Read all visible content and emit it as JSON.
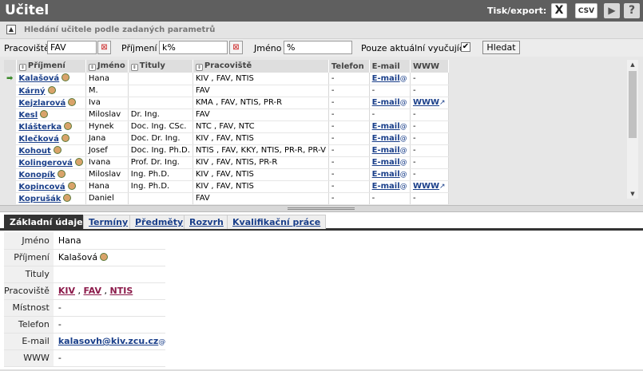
{
  "title": "Učitel",
  "export_label": "Tisk/export:",
  "icons": {
    "excel": "X",
    "csv": "CSV",
    "play": "▶",
    "help": "?"
  },
  "search": {
    "heading": "Hledání učitele podle zadaných parametrů",
    "pracoviste_label": "Pracoviště",
    "pracoviste_value": "FAV",
    "prijmeni_label": "Příjmení",
    "prijmeni_value": "k%",
    "jmeno_label": "Jméno",
    "jmeno_value": "%",
    "aktualni_label": "Pouze aktuální vyučující",
    "aktualni_checked": "✔",
    "button": "Hledat"
  },
  "grid": {
    "headers": [
      "Příjmení",
      "Jméno",
      "Tituly",
      "Pracoviště",
      "Telefon",
      "E-mail",
      "WWW"
    ],
    "rows": [
      {
        "prijmeni": "Kalašová",
        "person": true,
        "jmeno": "Hana",
        "tituly": "",
        "pracoviste": "KIV , FAV, NTIS",
        "telefon": "-",
        "email": "E-mail",
        "www": "-",
        "current": true
      },
      {
        "prijmeni": "Kárný",
        "person": true,
        "jmeno": "M.",
        "tituly": "",
        "pracoviste": "FAV",
        "telefon": "-",
        "email": "-",
        "www": "-"
      },
      {
        "prijmeni": "Kejzlarová",
        "person": true,
        "jmeno": "Iva",
        "tituly": "",
        "pracoviste": "KMA , FAV, NTIS, PR-R",
        "telefon": "-",
        "email": "E-mail",
        "www": "WWW"
      },
      {
        "prijmeni": "Kesl",
        "person": true,
        "jmeno": "Miloslav",
        "tituly": "Dr. Ing.",
        "pracoviste": "FAV",
        "telefon": "-",
        "email": "-",
        "www": "-"
      },
      {
        "prijmeni": "Klášterka",
        "person": true,
        "jmeno": "Hynek",
        "tituly": "Doc. Ing. CSc.",
        "pracoviste": "NTC , FAV, NTC",
        "telefon": "-",
        "email": "E-mail",
        "www": "-"
      },
      {
        "prijmeni": "Klečková",
        "person": true,
        "jmeno": "Jana",
        "tituly": "Doc. Dr. Ing.",
        "pracoviste": "KIV , FAV, NTIS",
        "telefon": "-",
        "email": "E-mail",
        "www": "-"
      },
      {
        "prijmeni": "Kohout",
        "person": true,
        "jmeno": "Josef",
        "tituly": "Doc. Ing. Ph.D.",
        "pracoviste": "NTIS , FAV, KKY, NTIS, PR-R, PR-V",
        "telefon": "-",
        "email": "E-mail",
        "www": "-"
      },
      {
        "prijmeni": "Kolingerová",
        "person": true,
        "jmeno": "Ivana",
        "tituly": "Prof. Dr. Ing.",
        "pracoviste": "KIV , FAV, NTIS, PR-R",
        "telefon": "-",
        "email": "E-mail",
        "www": "-"
      },
      {
        "prijmeni": "Konopík",
        "person": true,
        "jmeno": "Miloslav",
        "tituly": "Ing. Ph.D.",
        "pracoviste": "KIV , FAV, NTIS",
        "telefon": "-",
        "email": "E-mail",
        "www": "-"
      },
      {
        "prijmeni": "Kopincová",
        "person": true,
        "jmeno": "Hana",
        "tituly": "Ing. Ph.D.",
        "pracoviste": "KIV , FAV, NTIS",
        "telefon": "-",
        "email": "E-mail",
        "www": "WWW"
      },
      {
        "prijmeni": "Koprušák",
        "person": true,
        "jmeno": "Daniel",
        "tituly": "",
        "pracoviste": "FAV",
        "telefon": "-",
        "email": "-",
        "www": "-"
      }
    ]
  },
  "tabs": [
    "Základní údaje",
    "Termíny",
    "Předměty",
    "Rozvrh",
    "Kvalifikační práce"
  ],
  "detail": {
    "jmeno_label": "Jméno",
    "jmeno": "Hana",
    "prijmeni_label": "Příjmení",
    "prijmeni": "Kalašová",
    "tituly_label": "Tituly",
    "tituly": "",
    "pracoviste_label": "Pracoviště",
    "pracoviste": [
      "KIV",
      "FAV",
      "NTIS"
    ],
    "mistnost_label": "Místnost",
    "mistnost": "-",
    "telefon_label": "Telefon",
    "telefon": "-",
    "email_label": "E-mail",
    "email": "kalasovh@kiv.zcu.cz",
    "www_label": "WWW",
    "www": "-"
  }
}
